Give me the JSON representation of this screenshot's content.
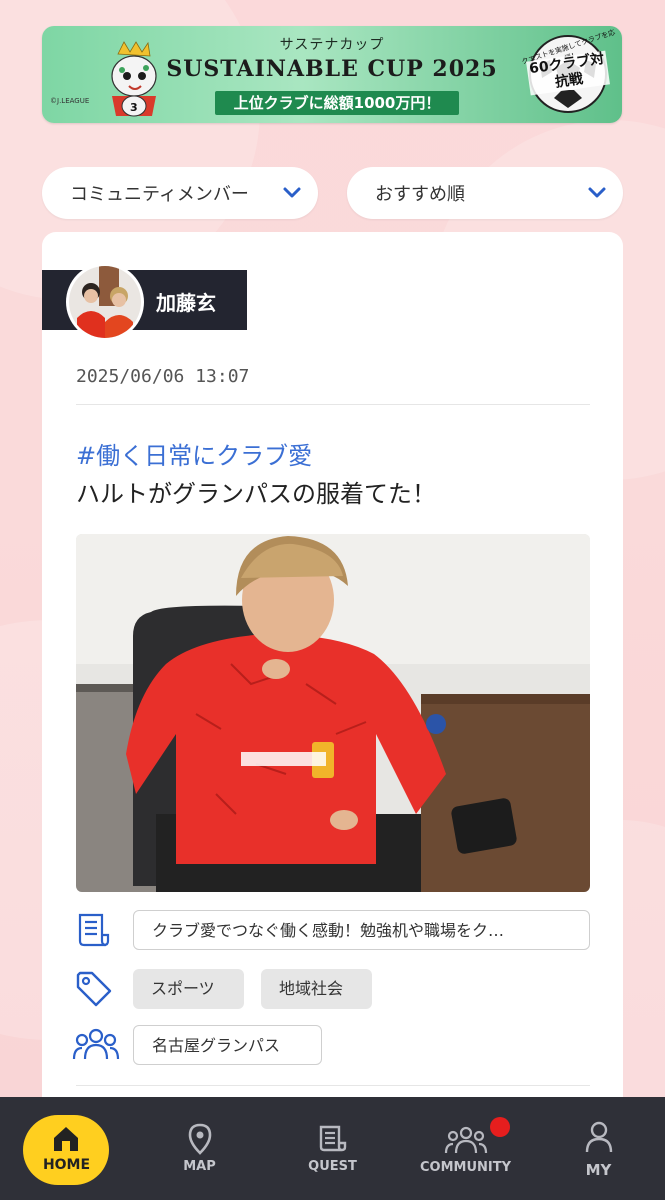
{
  "banner": {
    "subtitle": "サステナカップ",
    "title": "SUSTAINABLE CUP 2025",
    "prize": "上位クラブに総額1000万円！",
    "badge_top": "クエストを実施してクラブを応援！",
    "badge": "60クラブ対抗戦",
    "copyright": "©J.LEAGUE"
  },
  "filters": {
    "community": "コミュニティメンバー",
    "sort": "おすすめ順"
  },
  "post": {
    "username": "加藤玄",
    "date": "2025/06/06 13:07",
    "hashtag": "#働く日常にクラブ愛",
    "text": "ハルトがグランパスの服着てた！",
    "quest": "クラブ愛でつなぐ働く感動！勉強机や職場をク…",
    "tags": [
      "スポーツ",
      "地域社会"
    ],
    "club": "名古屋グランパス"
  },
  "nav": {
    "items": [
      {
        "label": "HOME",
        "icon": "home-icon"
      },
      {
        "label": "MAP",
        "icon": "map-pin-icon"
      },
      {
        "label": "QUEST",
        "icon": "quest-icon"
      },
      {
        "label": "COMMUNITY",
        "icon": "community-icon"
      },
      {
        "label": "MY",
        "icon": "user-icon"
      }
    ]
  },
  "colors": {
    "accent_blue": "#3b6fd4",
    "nav_bg": "#2f3038",
    "home_yellow": "#ffcf1f",
    "notification_red": "#e61e1e"
  }
}
